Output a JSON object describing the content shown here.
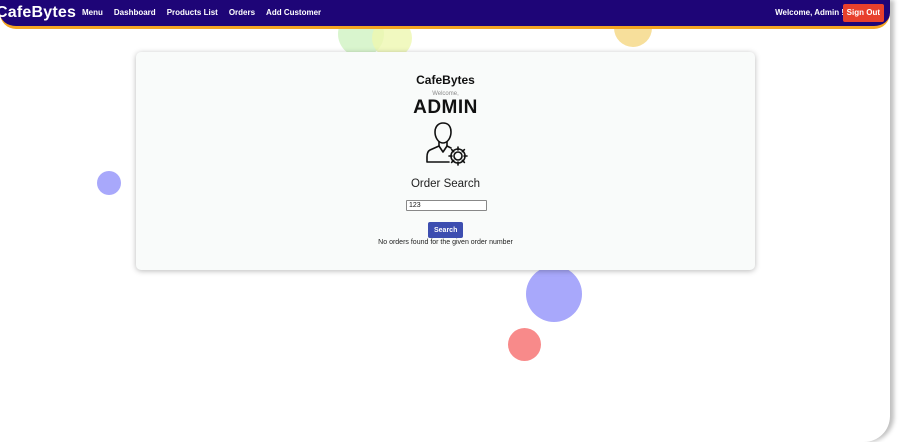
{
  "app": {
    "brand": "CafeBytes"
  },
  "nav": {
    "links": [
      "Menu",
      "Dashboard",
      "Products List",
      "Orders",
      "Add Customer"
    ],
    "welcome_text": "Welcome, Admin !",
    "signout_label": "Sign Out"
  },
  "card": {
    "title": "CafeBytes",
    "welcome_label": "Welcome,",
    "user_name": "ADMIN",
    "avatar_icon": "admin-user-gear-icon",
    "search_heading": "Order Search",
    "search_value": "123",
    "search_button_label": "Search",
    "result_message": "No orders found for the given order number"
  },
  "colors": {
    "navbar": "#1e0577",
    "navbar_accent": "#f5a623",
    "signout": "#e8402c",
    "search_button": "#3d4eb0",
    "bubble_blue": "#a8a8fb",
    "bubble_red": "#f88a8a",
    "bubble_yellow": "#f7df9b",
    "bubble_green": "#cff2c2"
  }
}
